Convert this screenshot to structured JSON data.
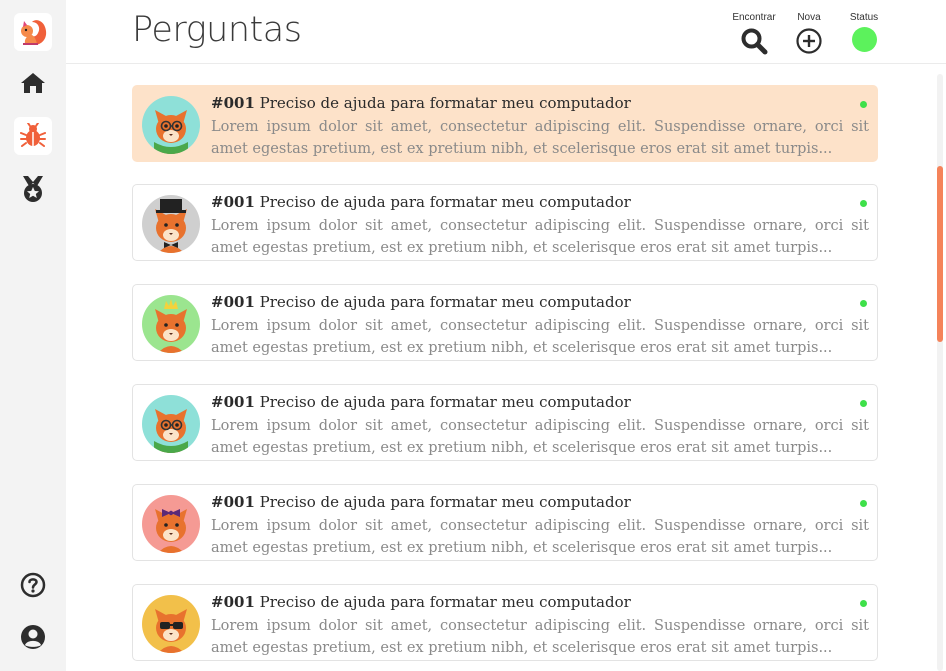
{
  "header": {
    "title": "Perguntas",
    "find_label": "Encontrar",
    "new_label": "Nova",
    "status_label": "Status",
    "status_color": "#5cf25c"
  },
  "sidebar": {
    "items": [
      {
        "name": "logo",
        "icon": "squirrel-logo-icon"
      },
      {
        "name": "home",
        "icon": "home-icon"
      },
      {
        "name": "bugs",
        "icon": "bug-icon",
        "active": true
      },
      {
        "name": "medals",
        "icon": "medal-star-icon"
      },
      {
        "name": "help",
        "icon": "question-circle-icon"
      },
      {
        "name": "profile",
        "icon": "user-circle-icon"
      }
    ]
  },
  "questions": [
    {
      "number": "#001",
      "title": "Preciso de ajuda para formatar meu computador",
      "excerpt": "Lorem ipsum dolor sit amet, consectetur adipiscing elit. Suspendisse ornare, orci sit amet egestas pretium, est ex pretium nibh, et scelerisque eros erat sit amet turpis...",
      "avatar_bg": "#8ee0d8",
      "avatar": "squirrel-glasses-scarf",
      "highlighted": true
    },
    {
      "number": "#001",
      "title": "Preciso de ajuda para formatar meu computador",
      "excerpt": "Lorem ipsum dolor sit amet, consectetur adipiscing elit. Suspendisse ornare, orci sit amet egestas pretium, est ex pretium nibh, et scelerisque eros erat sit amet turpis...",
      "avatar_bg": "#cfcfcf",
      "avatar": "squirrel-tophat-bowtie",
      "highlighted": false
    },
    {
      "number": "#001",
      "title": "Preciso de ajuda para formatar meu computador",
      "excerpt": "Lorem ipsum dolor sit amet, consectetur adipiscing elit. Suspendisse ornare, orci sit amet egestas pretium, est ex pretium nibh, et scelerisque eros erat sit amet turpis...",
      "avatar_bg": "#9be58f",
      "avatar": "squirrel-crown",
      "highlighted": false
    },
    {
      "number": "#001",
      "title": "Preciso de ajuda para formatar meu computador",
      "excerpt": "Lorem ipsum dolor sit amet, consectetur adipiscing elit. Suspendisse ornare, orci sit amet egestas pretium, est ex pretium nibh, et scelerisque eros erat sit amet turpis...",
      "avatar_bg": "#8ee0d8",
      "avatar": "squirrel-glasses-scarf",
      "highlighted": false
    },
    {
      "number": "#001",
      "title": "Preciso de ajuda para formatar meu computador",
      "excerpt": "Lorem ipsum dolor sit amet, consectetur adipiscing elit. Suspendisse ornare, orci sit amet egestas pretium, est ex pretium nibh, et scelerisque eros erat sit amet turpis...",
      "avatar_bg": "#f59a94",
      "avatar": "squirrel-bow",
      "highlighted": false
    },
    {
      "number": "#001",
      "title": "Preciso de ajuda para formatar meu computador",
      "excerpt": "Lorem ipsum dolor sit amet, consectetur adipiscing elit. Suspendisse ornare, orci sit amet egestas pretium, est ex pretium nibh, et scelerisque eros erat sit amet turpis...",
      "avatar_bg": "#f2c04a",
      "avatar": "squirrel-sunglasses",
      "highlighted": false
    }
  ]
}
